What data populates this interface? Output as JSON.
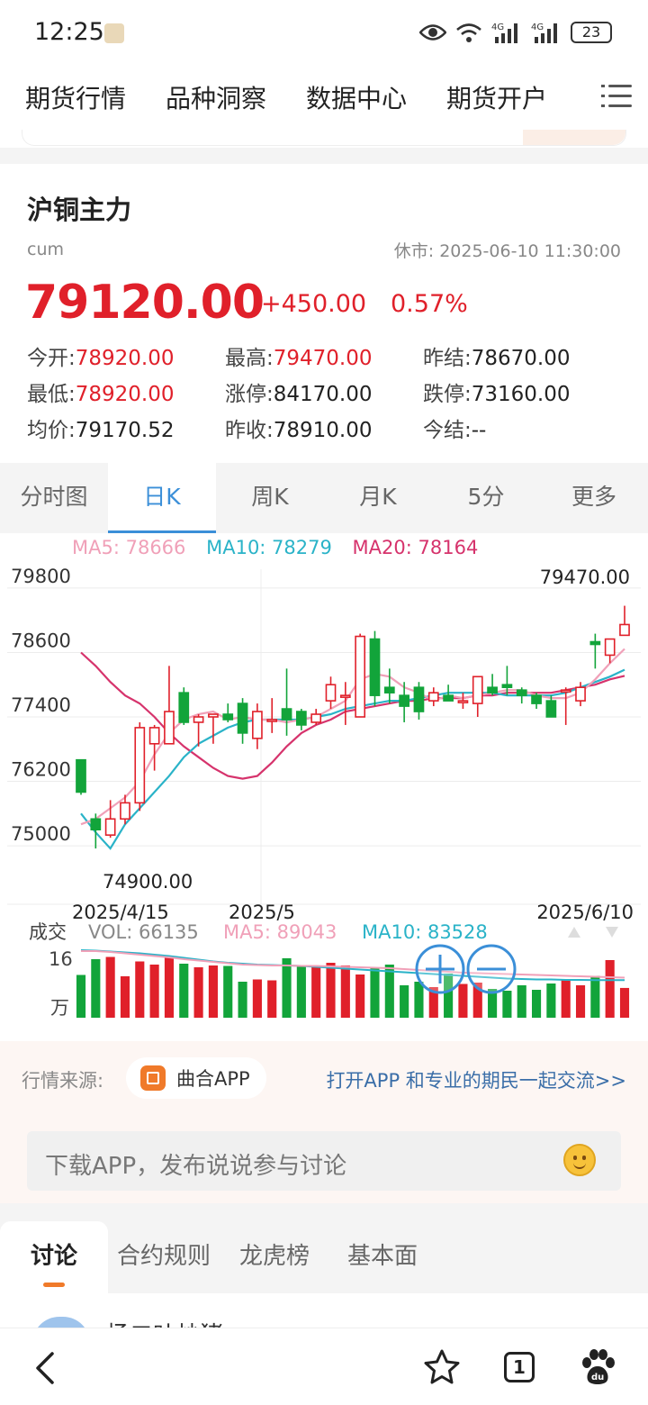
{
  "status_bar": {
    "time": "12:25",
    "battery": "23"
  },
  "top_nav": {
    "items": [
      "期货行情",
      "品种洞察",
      "数据中心",
      "期货开户"
    ]
  },
  "quote": {
    "name": "沪铜主力",
    "code": "cum",
    "status": "休市: 2025-06-10 11:30:00",
    "price": "79120.00",
    "change": "+450.00",
    "change_pct": "0.57%",
    "stats": [
      {
        "label": "今开:",
        "value": "78920.00",
        "red": true
      },
      {
        "label": "最高:",
        "value": "79470.00",
        "red": true
      },
      {
        "label": "昨结:",
        "value": "78670.00",
        "red": false
      },
      {
        "label": "最低:",
        "value": "78920.00",
        "red": true
      },
      {
        "label": "涨停:",
        "value": "84170.00",
        "red": false
      },
      {
        "label": "跌停:",
        "value": "73160.00",
        "red": false
      },
      {
        "label": "均价:",
        "value": "79170.52",
        "red": false
      },
      {
        "label": "昨收:",
        "value": "78910.00",
        "red": false
      },
      {
        "label": "今结:",
        "value": "--",
        "red": false
      }
    ]
  },
  "kline_tabs": [
    "分时图",
    "日K",
    "周K",
    "月K",
    "5分",
    "更多"
  ],
  "active_tab": 1,
  "colors": {
    "up": "#e0202a",
    "down": "#12a43a",
    "ma5": "#f0a0b8",
    "ma10": "#2ab3c8",
    "ma20": "#d6336c",
    "accent": "#3b8fd8"
  },
  "chart_data": {
    "type": "candlestick",
    "ma_legend": {
      "ma5": "MA5: 78666",
      "ma10": "MA10: 78279",
      "ma20": "MA20: 78164"
    },
    "y_ticks": [
      "79800",
      "78600",
      "77400",
      "76200",
      "75000"
    ],
    "y_tick_values": [
      79800,
      78600,
      77400,
      76200,
      75000
    ],
    "ylim": [
      74900,
      79800
    ],
    "x_labels": [
      "2025/4/15",
      "2025/5",
      "2025/6/10"
    ],
    "max_label": "79470.00",
    "min_label": "74900.00",
    "candles": [
      [
        76600,
        76550,
        75950,
        76000
      ],
      [
        75500,
        75600,
        74950,
        75300
      ],
      [
        75200,
        75850,
        75150,
        75500
      ],
      [
        75500,
        75950,
        75400,
        75800
      ],
      [
        75800,
        77300,
        75650,
        77200
      ],
      [
        76900,
        77250,
        76400,
        77200
      ],
      [
        76900,
        78350,
        76900,
        77500
      ],
      [
        77850,
        77950,
        77250,
        77300
      ],
      [
        77300,
        77450,
        76850,
        77400
      ],
      [
        77400,
        77450,
        76900,
        77450
      ],
      [
        77450,
        77650,
        77300,
        77350
      ],
      [
        77650,
        77750,
        76900,
        77100
      ],
      [
        77000,
        77650,
        76800,
        77500
      ],
      [
        77350,
        77750,
        77100,
        77350
      ],
      [
        77550,
        78300,
        77050,
        77350
      ],
      [
        77500,
        77550,
        77150,
        77250
      ],
      [
        77300,
        77550,
        77250,
        77450
      ],
      [
        77700,
        78150,
        77550,
        78000
      ],
      [
        77800,
        78050,
        77250,
        77800
      ],
      [
        77400,
        78950,
        77400,
        78900
      ],
      [
        78850,
        79000,
        77600,
        77800
      ],
      [
        77950,
        78300,
        77650,
        77850
      ],
      [
        77800,
        78050,
        77300,
        77600
      ],
      [
        77950,
        78050,
        77350,
        77500
      ],
      [
        77700,
        77950,
        77600,
        77850
      ],
      [
        77800,
        78000,
        77700,
        77700
      ],
      [
        77700,
        77850,
        77550,
        77700
      ],
      [
        77650,
        78000,
        77400,
        78150
      ],
      [
        77950,
        78200,
        77800,
        77850
      ],
      [
        78000,
        78350,
        77800,
        77950
      ],
      [
        77900,
        77950,
        77650,
        77800
      ],
      [
        77800,
        77850,
        77550,
        77650
      ],
      [
        77700,
        77800,
        77500,
        77400
      ],
      [
        77900,
        77950,
        77250,
        77900
      ],
      [
        77700,
        78050,
        77600,
        77950
      ],
      [
        78800,
        78950,
        78300,
        78750
      ],
      [
        78550,
        78800,
        78400,
        78850
      ],
      [
        78920,
        79470,
        78920,
        79120
      ]
    ],
    "ma5": [
      75400,
      75500,
      75700,
      75900,
      76200,
      76700,
      77100,
      77350,
      77450,
      77500,
      77350,
      77400,
      77350,
      77350,
      77300,
      77350,
      77400,
      77550,
      77700,
      78100,
      78200,
      78150,
      77950,
      77850,
      77700,
      77800,
      77750,
      77800,
      77850,
      77900,
      77900,
      77800,
      77750,
      77750,
      77850,
      78100,
      78400,
      78666
    ],
    "ma10": [
      75600,
      75250,
      74950,
      75400,
      75700,
      76000,
      76300,
      76650,
      76900,
      77050,
      77200,
      77300,
      77350,
      77350,
      77350,
      77350,
      77400,
      77450,
      77550,
      77600,
      77650,
      77700,
      77700,
      77750,
      77800,
      77850,
      77850,
      77850,
      77850,
      77800,
      77800,
      77800,
      77800,
      77850,
      77950,
      78050,
      78150,
      78279
    ],
    "ma20": [
      78600,
      78350,
      78050,
      77800,
      77650,
      77400,
      77100,
      76850,
      76650,
      76450,
      76300,
      76250,
      76300,
      76550,
      76850,
      77100,
      77250,
      77350,
      77500,
      77550,
      77600,
      77650,
      77700,
      77700,
      77750,
      77750,
      77750,
      77800,
      77800,
      77850,
      77850,
      77850,
      77850,
      77900,
      77950,
      78000,
      78100,
      78164
    ],
    "volume": {
      "label": "成交",
      "vol_label": "VOL: 66135",
      "ma5_label": "MA5: 89043",
      "ma10_label": "MA10: 83528",
      "unit_top": "16",
      "unit_bottom": "万",
      "values": [
        95000,
        130000,
        135000,
        92000,
        125000,
        118000,
        136000,
        120000,
        112000,
        116000,
        115000,
        80000,
        85000,
        83000,
        132000,
        116000,
        115000,
        122000,
        116000,
        96000,
        112000,
        118000,
        72000,
        80000,
        68000,
        98000,
        75000,
        78000,
        64000,
        60000,
        72000,
        62000,
        76000,
        84000,
        72000,
        93000,
        128000,
        66135
      ],
      "ma5": [
        148000,
        148000,
        146000,
        143000,
        140000,
        137000,
        134000,
        130000,
        127000,
        124000,
        121000,
        118000,
        117000,
        116000,
        116000,
        115000,
        115000,
        114000,
        113000,
        112000,
        111000,
        110000,
        108000,
        106000,
        104000,
        102000,
        100000,
        99000,
        98000,
        97000,
        96000,
        95000,
        94000,
        93000,
        92000,
        91000,
        90000,
        89043
      ],
      "ma10": [
        150000,
        149000,
        147000,
        145000,
        143000,
        140000,
        137000,
        133000,
        129000,
        125000,
        122000,
        120000,
        118000,
        117000,
        116000,
        115000,
        113000,
        111000,
        109000,
        107000,
        105000,
        103000,
        101000,
        99000,
        97000,
        95000,
        93000,
        91000,
        89000,
        87000,
        86000,
        85000,
        85000,
        84000,
        84000,
        83500,
        83500,
        83528
      ],
      "vmax": 160000
    }
  },
  "source": {
    "label": "行情来源:",
    "app_name": "曲合APP",
    "link": "打开APP 和专业的期民一起交流>>"
  },
  "comment": {
    "placeholder": "下载APP，发布说说参与讨论"
  },
  "bottom_tabs": [
    "讨论",
    "合约规则",
    "龙虎榜",
    "基本面"
  ],
  "list_preview": {
    "name": "杨二叶炒猪"
  },
  "browser": {
    "tab_count": "1"
  }
}
